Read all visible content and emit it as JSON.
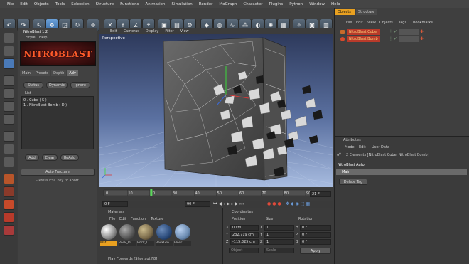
{
  "menubar": [
    "File",
    "Edit",
    "Objects",
    "Tools",
    "Selection",
    "Structure",
    "Functions",
    "Animation",
    "Simulation",
    "Render",
    "MoGraph",
    "Character",
    "Plugins",
    "Python",
    "Window",
    "Help"
  ],
  "plugin": {
    "title": "NitroBlast 1.2",
    "menu": [
      "Style",
      "Help"
    ],
    "banner": "NITROBLAST",
    "tabs": [
      "Main",
      "Presets",
      "Depth",
      "Adv"
    ],
    "buttons": [
      "Status",
      "Dynamic",
      "Ignore"
    ],
    "list_label": "List",
    "list_items": [
      "0 . Cube ( S )",
      "1 . NitroBlast Bomb ( D )"
    ],
    "list_buttons": [
      "Add",
      "Clear",
      "ReAdd"
    ],
    "fracture_button": "Auto Fracture",
    "hint": "- Press ESC key to abort"
  },
  "viewport": {
    "menu": [
      "Edit",
      "Cameras",
      "Display",
      "Filter",
      "View"
    ],
    "label": "Perspective"
  },
  "timeline": {
    "ticks": [
      "0",
      "10",
      "20",
      "30",
      "40",
      "50",
      "60",
      "70",
      "80",
      "90"
    ],
    "current_frame": "21 F",
    "start_field": "0 F",
    "end_field": "90 F",
    "progress": 0.23
  },
  "materials": {
    "title": "Materials",
    "menu": [
      "File",
      "Edit",
      "Function",
      "Texture"
    ],
    "items": [
      {
        "name": "Mat",
        "color": "#d8d8d8"
      },
      {
        "name": "Rock_O",
        "color": "#6a6a6a"
      },
      {
        "name": "Rock_I",
        "color": "#8a7a5a"
      },
      {
        "name": "BackGro",
        "color": "#3a5a8a"
      },
      {
        "name": "Floor",
        "color": "#6a8ab0"
      }
    ]
  },
  "coordinates": {
    "title": "Coordinates",
    "headers": [
      "Position",
      "Size",
      "Rotation"
    ],
    "rows": [
      {
        "axis": "X",
        "pos": "0 cm",
        "size_axis": "X",
        "size": "1",
        "rot_axis": "H",
        "rot": "0 °"
      },
      {
        "axis": "Y",
        "pos": "232.719 cm",
        "size_axis": "Y",
        "size": "1",
        "rot_axis": "P",
        "rot": "0 °"
      },
      {
        "axis": "Z",
        "pos": "-115.325 cm",
        "size_axis": "Z",
        "size": "1",
        "rot_axis": "B",
        "rot": "0 °"
      }
    ],
    "mode": "Object",
    "size_mode": "Scale",
    "apply": "Apply"
  },
  "objects": {
    "tabs": [
      "Objects",
      "Structure"
    ],
    "menu": [
      "File",
      "Edit",
      "View",
      "Objects",
      "Tags",
      "Bookmarks"
    ],
    "items": [
      "NitroBlast Cube",
      "NitroBlast Bomb"
    ]
  },
  "attributes": {
    "title": "Attributes",
    "menu": [
      "Mode",
      "Edit",
      "User Data"
    ],
    "selection": "2 Elements [NitroBlast Cube, NitroBlast Bomb]",
    "section": "NitroBlast Auto",
    "tab": "Main",
    "delete_tag": "Delete Tag"
  },
  "status": "Play Forwards [Shortcut F8]",
  "colors": {
    "accent": "#4a8ad8",
    "viewport_bg_top": "#3a4a6e",
    "viewport_bg_bottom": "#8fa8d0",
    "banner_text": "#ff5a2a"
  }
}
